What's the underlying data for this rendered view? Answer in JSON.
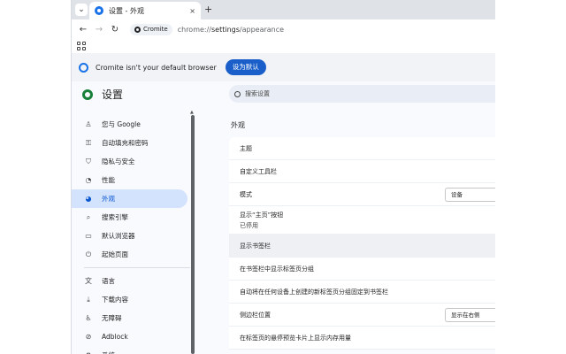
{
  "tab": {
    "title": "设置 - 外观",
    "close": "×",
    "new_tab": "+"
  },
  "tab_search": "⌄",
  "toolbar": {
    "back": "←",
    "forward": "→",
    "reload": "↻",
    "chip_label": "Cromite",
    "url_host": "chrome://",
    "url_settings": "settings",
    "url_path": "/appearance"
  },
  "infobar": {
    "message": "Cromite isn't your default browser",
    "button": "设为默认"
  },
  "settings": {
    "title": "设置",
    "search_placeholder": "搜索设置"
  },
  "sidebar": {
    "items": [
      {
        "label": "您与 Google",
        "icon": "person-icon",
        "glyph": "♙"
      },
      {
        "label": "自动填充和密码",
        "icon": "key-icon",
        "glyph": "⚿"
      },
      {
        "label": "隐私与安全",
        "icon": "shield-icon",
        "glyph": "⛉"
      },
      {
        "label": "性能",
        "icon": "speedometer-icon",
        "glyph": "◔"
      },
      {
        "label": "外观",
        "icon": "palette-icon",
        "glyph": "◕"
      },
      {
        "label": "搜索引擎",
        "icon": "search-icon",
        "glyph": "⌕"
      },
      {
        "label": "默认浏览器",
        "icon": "browser-icon",
        "glyph": "▭"
      },
      {
        "label": "起始页面",
        "icon": "power-icon",
        "glyph": "⏻"
      },
      {
        "label": "语言",
        "icon": "translate-icon",
        "glyph": "文"
      },
      {
        "label": "下载内容",
        "icon": "download-icon",
        "glyph": "⤓"
      },
      {
        "label": "无障碍",
        "icon": "accessibility-icon",
        "glyph": "♿"
      },
      {
        "label": "Adblock",
        "icon": "block-icon",
        "glyph": "⊘"
      },
      {
        "label": "系统",
        "icon": "wrench-icon",
        "glyph": "⚙"
      }
    ]
  },
  "appearance": {
    "section_title": "外观",
    "rows": [
      {
        "label": "主题"
      },
      {
        "label": "自定义工具栏"
      },
      {
        "label": "模式",
        "value": "设备"
      },
      {
        "label": "显示“主页”按钮",
        "sub": "已停用"
      },
      {
        "label": "显示书签栏"
      },
      {
        "label": "在书签栏中显示标签页分组"
      },
      {
        "label": "自动将在任何设备上创建的新标签页分组固定到书签栏"
      },
      {
        "label": "侧边栏位置",
        "value": "显示在右侧"
      },
      {
        "label": "在标签页的悬停预览卡片上显示内存用量"
      }
    ]
  },
  "colors": {
    "accent": "#1a73e8",
    "active_nav_bg": "#d3e3fd",
    "infobar_button": "#1a5fc9",
    "brand_logo": "#188038"
  }
}
